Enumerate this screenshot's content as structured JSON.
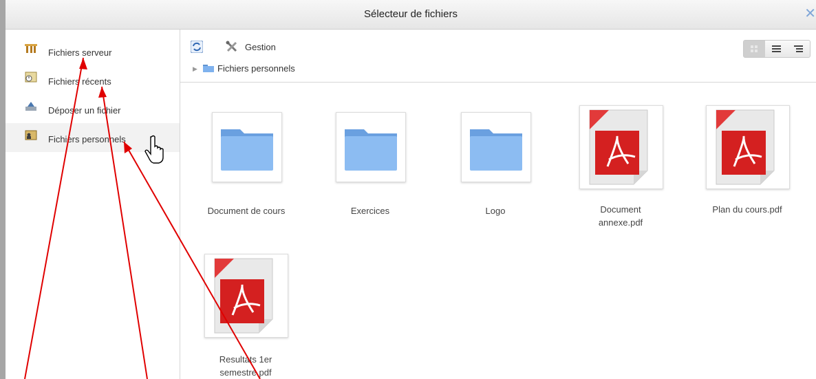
{
  "dialog": {
    "title": "Sélecteur de fichiers",
    "close_glyph": "✕"
  },
  "sidebar": {
    "items": [
      {
        "label": "Fichiers serveur",
        "icon": "server-files-icon"
      },
      {
        "label": "Fichiers récents",
        "icon": "recent-files-icon"
      },
      {
        "label": "Déposer un fichier",
        "icon": "upload-icon"
      },
      {
        "label": "Fichiers personnels",
        "icon": "private-files-icon",
        "active": true
      }
    ]
  },
  "toolbar": {
    "refresh_icon": "refresh-icon",
    "manage_label": "Gestion",
    "manage_icon": "tools-icon",
    "view_modes": [
      "icons",
      "list",
      "tree"
    ],
    "active_view": "icons"
  },
  "breadcrumb": {
    "path_label": "Fichiers personnels"
  },
  "files": [
    {
      "name": "Document de cours",
      "type": "folder"
    },
    {
      "name": "Exercices",
      "type": "folder"
    },
    {
      "name": "Logo",
      "type": "folder"
    },
    {
      "name": "Document annexe.pdf",
      "line1": "Document",
      "line2": "annexe.pdf",
      "type": "pdf"
    },
    {
      "name": "Plan du cours.pdf",
      "type": "pdf"
    },
    {
      "name": "Resultats 1er semestre.pdf",
      "line1": "Resultats 1er",
      "line2": "semestre.pdf",
      "type": "pdf"
    }
  ],
  "colors": {
    "annotation_arrows": "#e00000",
    "folder": "#7fb2ee",
    "pdf": "#d42020"
  }
}
